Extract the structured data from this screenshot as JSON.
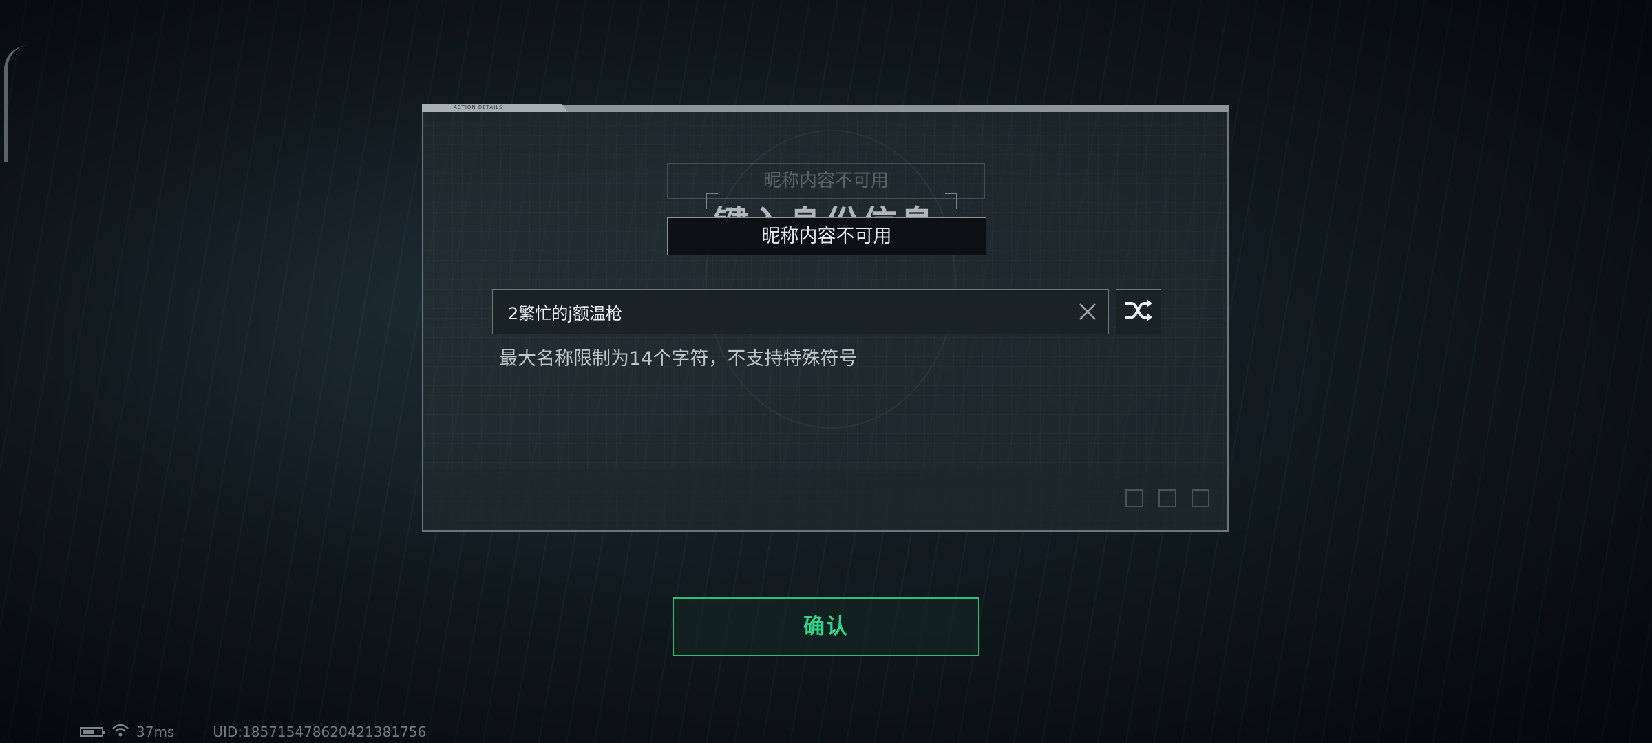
{
  "dialog": {
    "tab_label": "ACTION DETAILS",
    "title": "键入身份信息",
    "ghost_notice": "昵称内容不可用",
    "notice": "昵称内容不可用",
    "name_input_value": "2繁忙的j额温枪",
    "hint": "最大名称限制为14个字符，不支持特殊符号"
  },
  "buttons": {
    "confirm": "确认",
    "clear_icon": "close-icon",
    "random_icon": "shuffle-icon"
  },
  "status_bar": {
    "ping": "37ms",
    "uid": "UID:1857154786204213817​56"
  },
  "colors": {
    "accent": "#2fd387",
    "accent_border": "#2dbd79",
    "notice_bg": "#0c1012"
  }
}
